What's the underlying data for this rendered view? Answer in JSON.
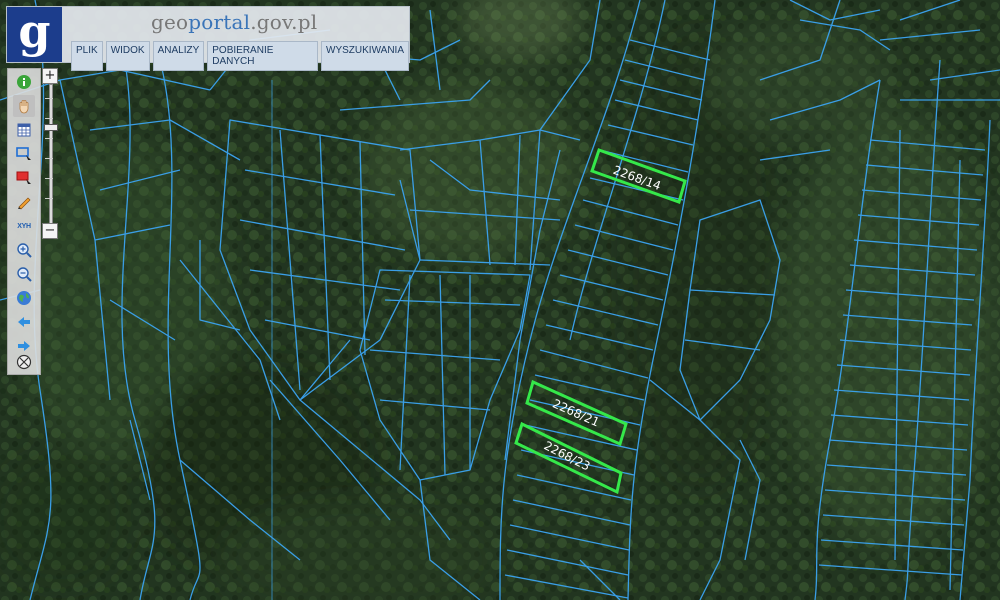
{
  "app": {
    "logo_letter": "g",
    "title_part1": "geo",
    "title_part2": "portal",
    "title_part3": ".gov.pl"
  },
  "menu": [
    {
      "label": "PLIK"
    },
    {
      "label": "WIDOK"
    },
    {
      "label": "ANALIZY"
    },
    {
      "label": "POBIERANIE DANYCH"
    },
    {
      "label": "WYSZUKIWANIA"
    }
  ],
  "tools": [
    {
      "name": "info-icon"
    },
    {
      "name": "pan-hand-icon"
    },
    {
      "name": "table-icon"
    },
    {
      "name": "select-rectangle-icon"
    },
    {
      "name": "deselect-rectangle-icon"
    },
    {
      "name": "draw-pencil-icon"
    },
    {
      "name": "xyz-coordinates-icon",
      "text": "XYH"
    },
    {
      "name": "zoom-in-icon"
    },
    {
      "name": "zoom-out-icon"
    },
    {
      "name": "full-extent-globe-icon"
    },
    {
      "name": "previous-view-arrow-icon"
    },
    {
      "name": "next-view-arrow-icon"
    },
    {
      "name": "clear-icon"
    }
  ],
  "zoom": {
    "plus": "+",
    "minus": "−"
  },
  "parcels": [
    {
      "label": "2268/14"
    },
    {
      "label": "2268/21"
    },
    {
      "label": "2268/23"
    }
  ],
  "colors": {
    "parcel_line": "#3a9ee6",
    "highlight": "#35e84a",
    "forest": "#24391f",
    "logo_bg": "#1c3d8c"
  }
}
